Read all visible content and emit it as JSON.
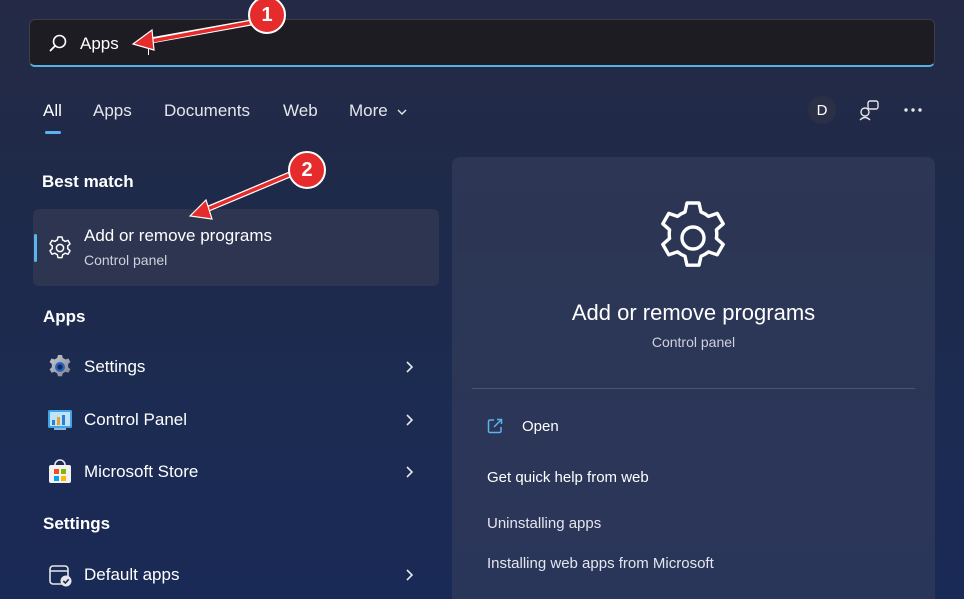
{
  "search": {
    "value": "Apps",
    "icon": "search-icon"
  },
  "tabs": [
    {
      "label": "All",
      "active": true
    },
    {
      "label": "Apps"
    },
    {
      "label": "Documents"
    },
    {
      "label": "Web"
    },
    {
      "label": "More"
    }
  ],
  "header_buttons": {
    "avatar_initial": "D",
    "people_icon": "people-icon",
    "more_icon": "ellipsis-icon"
  },
  "best_match": {
    "heading": "Best match",
    "title": "Add or remove programs",
    "subtitle": "Control panel",
    "icon": "gear-icon"
  },
  "apps": {
    "heading": "Apps",
    "items": [
      {
        "label": "Settings",
        "icon": "settings-app-icon"
      },
      {
        "label": "Control Panel",
        "icon": "control-panel-icon"
      },
      {
        "label": "Microsoft Store",
        "icon": "microsoft-store-icon"
      }
    ]
  },
  "settings": {
    "heading": "Settings",
    "items": [
      {
        "label": "Default apps",
        "icon": "default-apps-icon"
      }
    ]
  },
  "detail": {
    "title": "Add or remove programs",
    "subtitle": "Control panel",
    "open_label": "Open",
    "web_help_heading": "Get quick help from web",
    "links": [
      "Uninstalling apps",
      "Installing web apps from Microsoft"
    ]
  },
  "annotations": {
    "badge_1": "1",
    "badge_2": "2"
  },
  "colors": {
    "accent": "#5ab4f0",
    "badge": "#e52b2b"
  }
}
